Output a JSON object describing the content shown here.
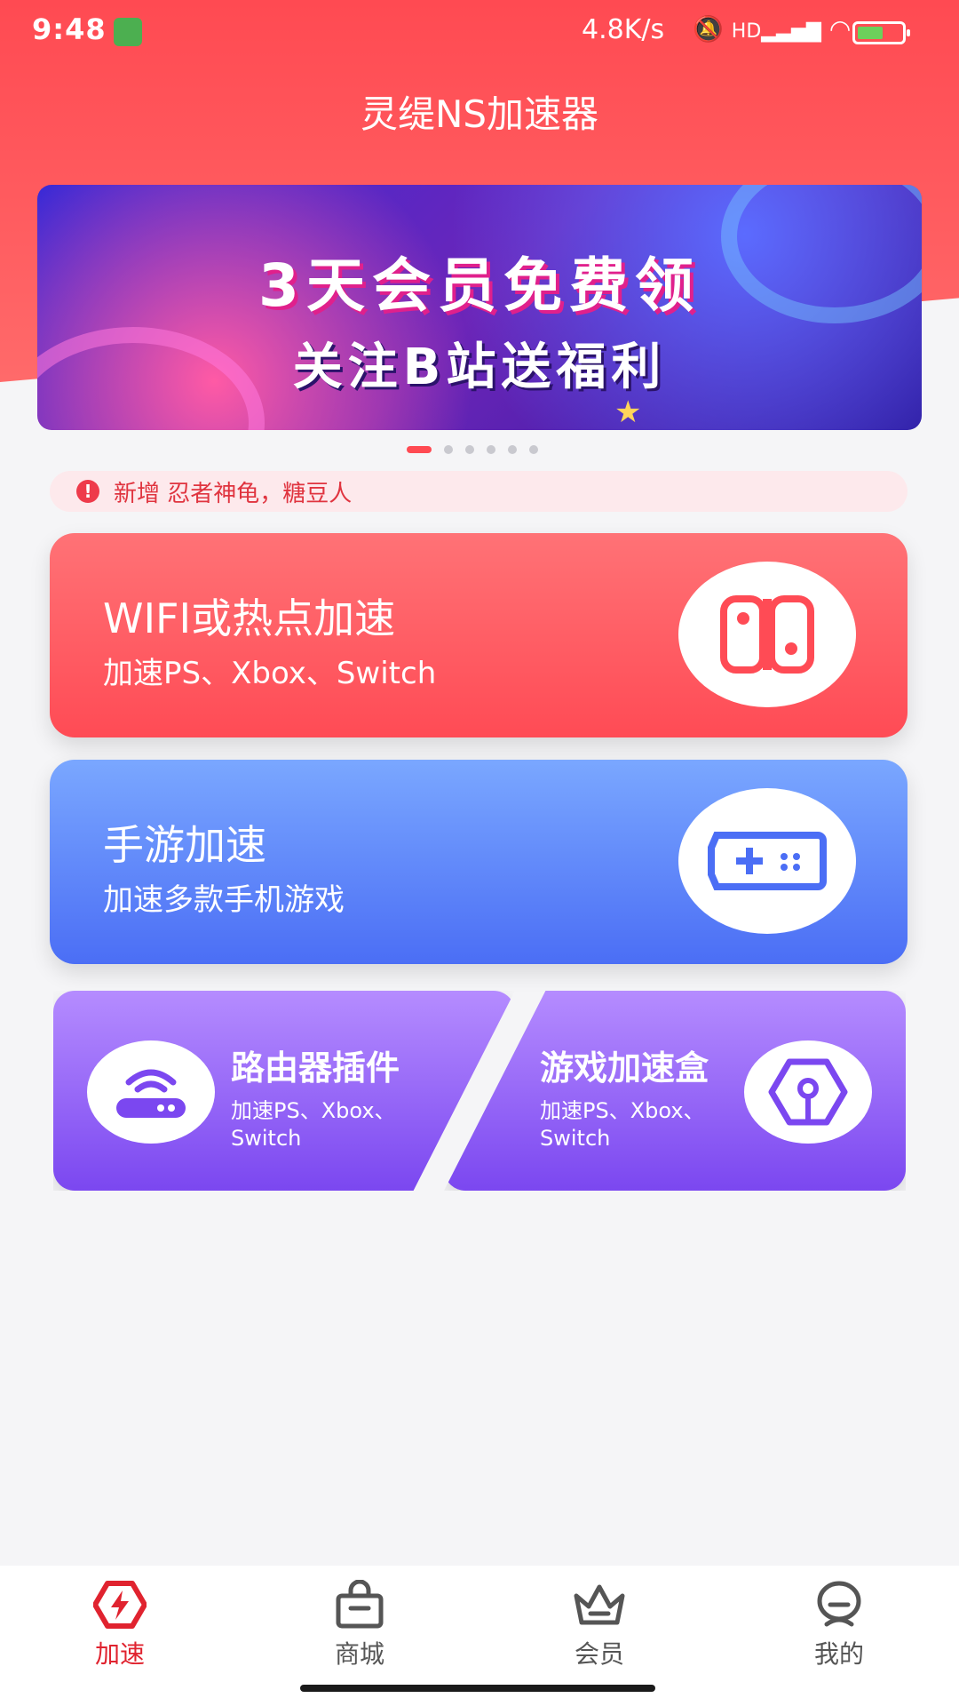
{
  "status_bar": {
    "time": "9:48",
    "net_speed": "4.8K/s",
    "icons": [
      "app-notification-icon",
      "mute-icon",
      "hd-signal-icon",
      "wifi-icon",
      "battery-charging-icon"
    ]
  },
  "header": {
    "title": "灵缇NS加速器"
  },
  "banner": {
    "line1": "3天会员免费领",
    "line2": "关注B站送福利",
    "page_count": 6,
    "active_page": 1
  },
  "notice": {
    "text": "新增 忍者神龟，糖豆人"
  },
  "cards": [
    {
      "title": "WIFI或热点加速",
      "subtitle": "加速PS、Xbox、Switch",
      "icon": "switch-console-icon",
      "color": "#ff4b55"
    },
    {
      "title": "手游加速",
      "subtitle": "加速多款手机游戏",
      "icon": "gamepad-icon",
      "color": "#4b6ef5"
    }
  ],
  "tiles": [
    {
      "title": "路由器插件",
      "subtitle_line1": "加速PS、Xbox、",
      "subtitle_line2": "Switch",
      "icon": "router-icon"
    },
    {
      "title": "游戏加速盒",
      "subtitle_line1": "加速PS、Xbox、",
      "subtitle_line2": "Switch",
      "icon": "hex-box-icon"
    }
  ],
  "bottom_nav": [
    {
      "label": "加速",
      "icon": "lightning-hex-icon",
      "active": true
    },
    {
      "label": "商城",
      "icon": "shopping-bag-icon",
      "active": false
    },
    {
      "label": "会员",
      "icon": "crown-icon",
      "active": false
    },
    {
      "label": "我的",
      "icon": "profile-icon",
      "active": false
    }
  ],
  "colors": {
    "brand_red": "#ff4a52",
    "blue": "#4b6ef5",
    "purple": "#7b47f0",
    "active_nav": "#e0232f"
  }
}
